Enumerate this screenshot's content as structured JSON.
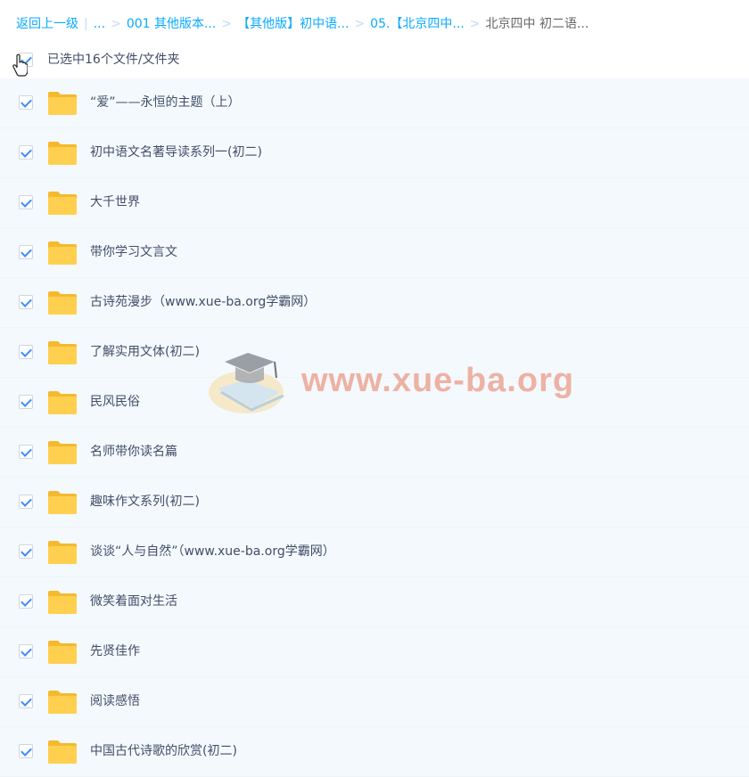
{
  "breadcrumb": {
    "back": "返回上一级",
    "pipe": "|",
    "ellipsis": "...",
    "items": [
      "001 其他版本...",
      "【其他版】初中语...",
      "05.【北京四中...",
      "北京四中 初二语..."
    ],
    "separator": ">"
  },
  "selection": {
    "label": "已选中16个文件/文件夹"
  },
  "files": [
    {
      "name": "“爱”——永恒的主题（上）"
    },
    {
      "name": "初中语文名著导读系列一(初二)"
    },
    {
      "name": "大千世界"
    },
    {
      "name": "带你学习文言文"
    },
    {
      "name": "古诗苑漫步（www.xue-ba.org学霸网）"
    },
    {
      "name": "了解实用文体(初二)"
    },
    {
      "name": "民风民俗"
    },
    {
      "name": "名师带你读名篇"
    },
    {
      "name": "趣味作文系列(初二)"
    },
    {
      "name": "谈谈“人与自然”（www.xue-ba.org学霸网）"
    },
    {
      "name": "微笑着面对生活"
    },
    {
      "name": "先贤佳作"
    },
    {
      "name": "阅读感悟"
    },
    {
      "name": "中国古代诗歌的欣赏(初二)"
    }
  ],
  "watermark": {
    "text": "www.xue-ba.org"
  },
  "colors": {
    "link": "#09aaff",
    "check": "#3b8cff",
    "folder": "#ffd04f",
    "row_bg": "#f4f9fe"
  },
  "icons": {
    "folder": "folder-icon",
    "cursor": "hand-cursor-icon",
    "check": "checkbox-checked-icon"
  }
}
